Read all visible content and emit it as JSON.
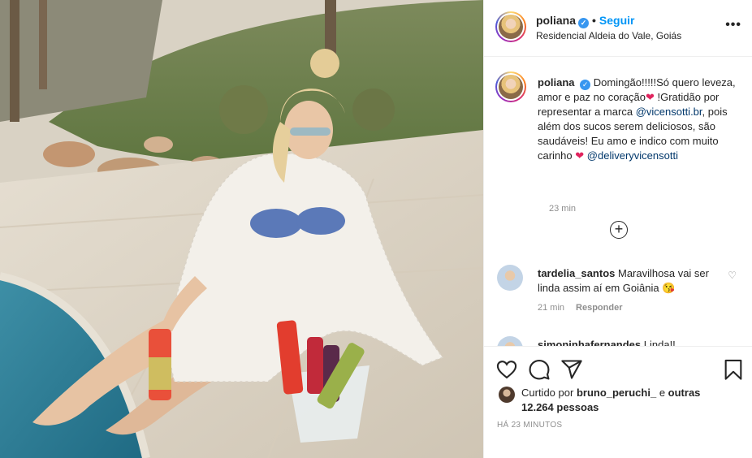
{
  "header": {
    "username": "poliana",
    "follow_label": "Seguir",
    "location": "Residencial Aldeia do Vale, Goiás",
    "dot": "•",
    "more": "•••"
  },
  "caption": {
    "username": "poliana",
    "text_1": "Domingão!!!!!Só quero leveza, amor e paz no coração",
    "text_2": "!Gratidão por representar a marca",
    "mention_1": "@vicensotti.br",
    "text_3": ", pois além dos sucos serem deliciosos, são saudáveis! Eu amo e indico com muito carinho",
    "mention_2": "@deliveryvicensotti",
    "heart": "❤",
    "time": "23 min"
  },
  "load_more": "+",
  "comments": [
    {
      "username": "tardelia_santos",
      "text": "Maravilhosa vai ser linda assim aí em Goiânia",
      "emoji": "😘",
      "time": "21 min",
      "reply_label": "Responder",
      "like": "♡"
    },
    {
      "username": "simoninhafernandes",
      "text": "Linda!!"
    }
  ],
  "likes": {
    "prefix": "Curtido por",
    "user": "bruno_peruchi_",
    "middle": "e",
    "others": "outras 12.264 pessoas"
  },
  "timestamp": "HÁ 23 MINUTOS",
  "colors": {
    "accent": "#0095f6",
    "verified": "#3897f0",
    "link": "#00376b",
    "muted": "#8e8e8e",
    "heart": "#e0245e"
  },
  "icons": [
    "verified-badge-icon",
    "more-options-icon",
    "add-circle-icon",
    "heart-icon",
    "comment-icon",
    "share-icon",
    "bookmark-icon"
  ]
}
